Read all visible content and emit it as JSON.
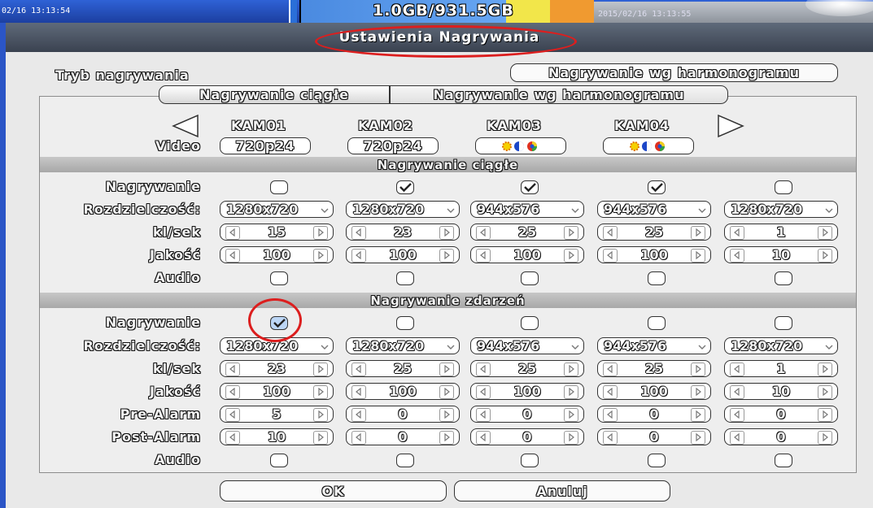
{
  "topbar": {
    "timestamp_left": "02/16 13:13:54",
    "storage": "1.0GB/931.5GB",
    "timestamp_right": "2015/02/16 13:13:55"
  },
  "dialog": {
    "title": "Ustawienia Nagrywania",
    "mode_label": "Tryb nagrywania",
    "mode_value": "Nagrywanie wg harmonogramu",
    "tabs": [
      "Nagrywanie ciągłe",
      "Nagrywanie wg harmonogramu"
    ],
    "video_label": "Video",
    "cameras": [
      {
        "name": "KAM01",
        "video": "720p24"
      },
      {
        "name": "KAM02",
        "video": "720p24"
      },
      {
        "name": "KAM03",
        "video": "no-signal-icon"
      },
      {
        "name": "KAM04",
        "video": "no-signal-icon"
      }
    ],
    "continuous": {
      "title": "Nagrywanie ciągłe",
      "labels": {
        "record": "Nagrywanie",
        "resolution": "Rozdzielczość:",
        "fps": "kl/sek",
        "quality": "Jakość",
        "audio": "Audio"
      },
      "record": [
        false,
        true,
        true,
        true,
        false
      ],
      "resolution": [
        "1280x720",
        "1280x720",
        "944x576",
        "944x576",
        "1280x720"
      ],
      "fps": [
        "15",
        "23",
        "25",
        "25",
        "1"
      ],
      "quality": [
        "100",
        "100",
        "100",
        "100",
        "10"
      ],
      "audio": [
        false,
        false,
        false,
        false,
        false
      ]
    },
    "event": {
      "title": "Nagrywanie zdarzeń",
      "labels": {
        "record": "Nagrywanie",
        "resolution": "Rozdzielczość:",
        "fps": "kl/sek",
        "quality": "Jakość",
        "prealarm": "Pre-Alarm",
        "postalarm": "Post-Alarm",
        "audio": "Audio"
      },
      "record": [
        true,
        false,
        false,
        false,
        false
      ],
      "resolution": [
        "1280x720",
        "1280x720",
        "944x576",
        "944x576",
        "1280x720"
      ],
      "fps": [
        "23",
        "25",
        "25",
        "25",
        "1"
      ],
      "quality": [
        "100",
        "100",
        "100",
        "100",
        "10"
      ],
      "prealarm": [
        "5",
        "0",
        "0",
        "0",
        "0"
      ],
      "postalarm": [
        "10",
        "0",
        "0",
        "0",
        "0"
      ],
      "audio": [
        false,
        false,
        false,
        false,
        false
      ]
    },
    "ok_label": "OK",
    "cancel_label": "Anuluj"
  }
}
